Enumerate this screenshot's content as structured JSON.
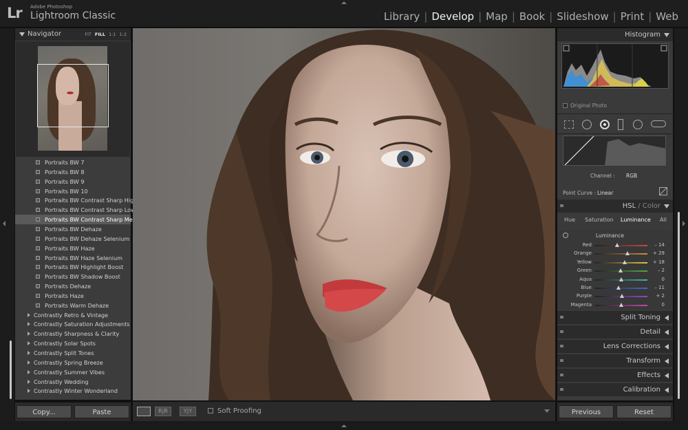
{
  "app": {
    "logo": "Lr",
    "brand_small": "Adobe Photoshop",
    "brand_big": "Lightroom Classic"
  },
  "modules": [
    {
      "label": "Library",
      "active": false
    },
    {
      "label": "Develop",
      "active": true
    },
    {
      "label": "Map",
      "active": false
    },
    {
      "label": "Book",
      "active": false
    },
    {
      "label": "Slideshow",
      "active": false
    },
    {
      "label": "Print",
      "active": false
    },
    {
      "label": "Web",
      "active": false
    }
  ],
  "navigator": {
    "title": "Navigator",
    "zoom": [
      "FIT",
      "FILL",
      "1:1",
      "1:2"
    ],
    "zoom_active": "FILL"
  },
  "presets": {
    "items": [
      "Portraits BW 7",
      "Portraits BW 8",
      "Portraits BW 9",
      "Portraits BW 10",
      "Portraits BW Contrast Sharp High",
      "Portraits BW Contrast Sharp Low",
      "Portraits BW Contrast Sharp Medium",
      "Portraits BW Dehaze",
      "Portraits BW Dehaze Selenium",
      "Portraits BW Haze",
      "Portraits BW Haze Selenium",
      "Portraits BW Highlight Boost",
      "Portraits BW Shadow Boost",
      "Portraits Dehaze",
      "Portraits Haze",
      "Portraits Warm Dehaze"
    ],
    "selected": "Portraits BW Contrast Sharp Medium",
    "folders": [
      "Contrastly Retro & Vintage",
      "Contrastly Saturation Adjustments",
      "Contrastly Sharpness & Clarity",
      "Contrastly Solar Spots",
      "Contrastly Split Tones",
      "Contrastly Spring Breeze",
      "Contrastly Summer Vibes",
      "Contrastly Wedding",
      "Contrastly Winter Wonderland"
    ]
  },
  "left_buttons": {
    "copy": "Copy...",
    "paste": "Paste"
  },
  "toolbar": {
    "soft_proofing": "Soft Proofing",
    "before_after": "R|R",
    "yy": "Y|Y"
  },
  "histogram": {
    "title": "Histogram",
    "original_photo": "Original Photo"
  },
  "tone_curve": {
    "channel_label": "Channel :",
    "channel_value": "RGB",
    "point_curve_label": "Point Curve :",
    "point_curve_value": "Linear"
  },
  "hsl": {
    "title_hsl": "HSL",
    "title_sep": " / ",
    "title_color": "Color",
    "tabs": [
      "Hue",
      "Saturation",
      "Luminance",
      "All"
    ],
    "active_tab": "Luminance",
    "section_label": "Luminance",
    "sliders": [
      {
        "name": "Red",
        "value": "– 14",
        "pos": 0.42,
        "color": "#d04545"
      },
      {
        "name": "Orange",
        "value": "+ 29",
        "pos": 0.62,
        "color": "#d68a3b"
      },
      {
        "name": "Yellow",
        "value": "+ 18",
        "pos": 0.57,
        "color": "#d8c83c"
      },
      {
        "name": "Green",
        "value": "– 2",
        "pos": 0.49,
        "color": "#53a645"
      },
      {
        "name": "Aqua",
        "value": "0",
        "pos": 0.5,
        "color": "#3fb4ad"
      },
      {
        "name": "Blue",
        "value": "– 11",
        "pos": 0.45,
        "color": "#3e6bd0"
      },
      {
        "name": "Purple",
        "value": "+ 2",
        "pos": 0.51,
        "color": "#8a4cc8"
      },
      {
        "name": "Magenta",
        "value": "0",
        "pos": 0.5,
        "color": "#c447a8"
      }
    ]
  },
  "panels": [
    "Split Toning",
    "Detail",
    "Lens Corrections",
    "Transform",
    "Effects",
    "Calibration"
  ],
  "right_buttons": {
    "previous": "Previous",
    "reset": "Reset"
  }
}
